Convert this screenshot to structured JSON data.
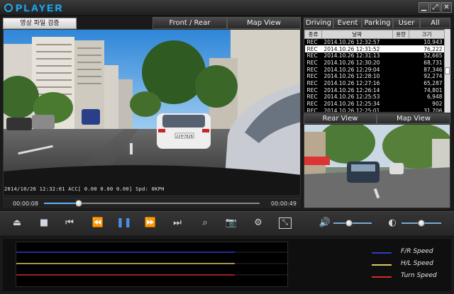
{
  "app": {
    "title_logo": "PLAYER",
    "window_buttons": [
      "minimize-icon",
      "maximize-icon",
      "close-icon"
    ]
  },
  "toolbar": {
    "verify_label": "영상 파일 검증",
    "front_rear_label": "Front / Rear",
    "map_view_label": "Map View"
  },
  "event_tabs": [
    "Driving",
    "Event",
    "Parking",
    "User",
    "All"
  ],
  "event_table": {
    "headers": [
      "종류",
      "날짜",
      "용량",
      "크기"
    ],
    "rows": [
      {
        "type": "REC",
        "date": "2014.10.26 12:32:57",
        "space": "",
        "size": "10,943",
        "selected": false
      },
      {
        "type": "REC",
        "date": "2014.10.26 12:31:52",
        "space": "",
        "size": "76,222",
        "selected": true
      },
      {
        "type": "REC",
        "date": "2014.10.26 12:31:13",
        "space": "",
        "size": "52,665",
        "selected": false
      },
      {
        "type": "REC",
        "date": "2014.10.26 12:30:20",
        "space": "",
        "size": "68,731",
        "selected": false
      },
      {
        "type": "REC",
        "date": "2014.10.26 12:29:04",
        "space": "",
        "size": "87,346",
        "selected": false
      },
      {
        "type": "REC",
        "date": "2014.10.26 12:28:10",
        "space": "",
        "size": "92,274",
        "selected": false
      },
      {
        "type": "REC",
        "date": "2014.10.26 12:27:16",
        "space": "",
        "size": "65,287",
        "selected": false
      },
      {
        "type": "REC",
        "date": "2014.10.26 12:26:14",
        "space": "",
        "size": "74,801",
        "selected": false
      },
      {
        "type": "REC",
        "date": "2014.10.26 12:25:53",
        "space": "",
        "size": "6,948",
        "selected": false
      },
      {
        "type": "REC",
        "date": "2014.10.26 12:25:34",
        "space": "",
        "size": "902",
        "selected": false
      },
      {
        "type": "REC",
        "date": "2014.10.26 12:25:01",
        "space": "",
        "size": "31,706",
        "selected": false
      }
    ]
  },
  "sub_views": {
    "rear_label": "Rear View",
    "map_label": "Map View"
  },
  "video": {
    "osd_text": "2014/10/26 12:32:01  ACC[ 0.00  0.00  0.00] Spd:  0KPH",
    "current_time": "00:00:08",
    "total_time": "00:00:49",
    "seek_fraction": 0.16,
    "plate_text": "22무7826"
  },
  "controls": {
    "buttons": [
      "eject-icon",
      "stop-icon",
      "skip-back-icon",
      "rewind-icon",
      "pause-icon",
      "fast-forward-icon",
      "skip-forward-icon",
      "zoom-icon",
      "camera-icon",
      "settings-icon",
      "fullscreen-icon"
    ],
    "volume_level": 0.4,
    "brightness_level": 0.5
  },
  "graph": {
    "legend": [
      {
        "label": "F/R Speed",
        "color": "#2a3cc8"
      },
      {
        "label": "H/L Speed",
        "color": "#d6cc5a"
      },
      {
        "label": "Turn Speed",
        "color": "#d02a2a"
      }
    ]
  }
}
